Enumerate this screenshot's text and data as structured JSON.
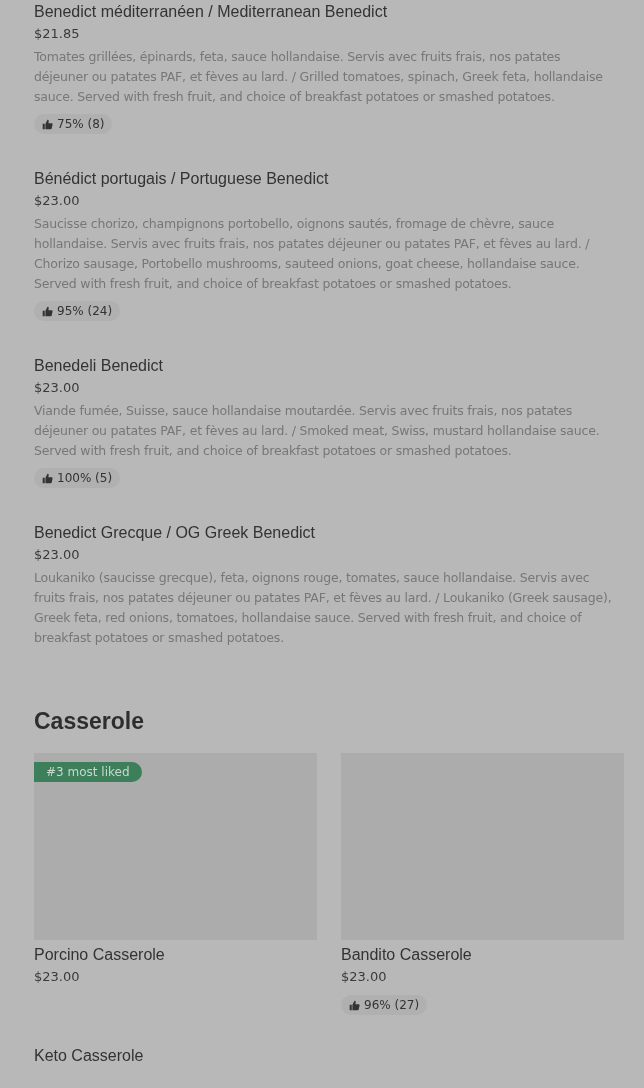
{
  "items": [
    {
      "title": "Benedict méditerranéen / Mediterranean Benedict",
      "price": "$21.85",
      "description": "Tomates grillées, épinards, feta, sauce hollandaise. Servis avec fruits frais, nos patates déjeuner ou patates PAF, et fèves au lard. / Grilled tomatoes, spinach, Greek feta, hollandaise sauce. Served with fresh fruit, and choice of breakfast potatoes or smashed potatoes.",
      "rating": "75% (8)"
    },
    {
      "title": "Bénédict portugais / Portuguese Benedict",
      "price": "$23.00",
      "description": "Saucisse chorizo, champignons portobello, oignons sautés, fromage de chèvre, sauce hollandaise. Servis avec fruits frais, nos patates déjeuner ou patates PAF, et fèves au lard. / Chorizo sausage, Portobello mushrooms, sauteed onions, goat cheese, hollandaise sauce. Served with fresh fruit, and choice of breakfast potatoes or smashed potatoes.",
      "rating": "95% (24)"
    },
    {
      "title": "Benedeli Benedict",
      "price": "$23.00",
      "description": "Viande fumée, Suisse, sauce hollandaise moutardée. Servis avec fruits frais, nos patates déjeuner ou patates PAF, et fèves au lard. / Smoked meat, Swiss, mustard hollandaise sauce. Served with fresh fruit, and choice of breakfast potatoes or smashed potatoes.",
      "rating": "100% (5)"
    },
    {
      "title": "Benedict Grecque / OG Greek Benedict",
      "price": "$23.00",
      "description": "Loukaniko (saucisse grecque), feta, oignons rouge, tomates, sauce hollandaise. Servis avec fruits frais, nos patates déjeuner ou patates PAF, et fèves au lard. / Loukaniko (Greek sausage), Greek feta, red onions, tomatoes, hollandaise sauce. Served with fresh fruit, and choice of breakfast potatoes or smashed potatoes."
    }
  ],
  "section": {
    "title": "Casserole",
    "cards": [
      {
        "badge": "#3 most liked",
        "title": "Porcino Casserole",
        "price": "$23.00"
      },
      {
        "title": "Bandito Casserole",
        "price": "$23.00",
        "rating": "96% (27)"
      }
    ],
    "next_item": "Keto Casserole"
  }
}
